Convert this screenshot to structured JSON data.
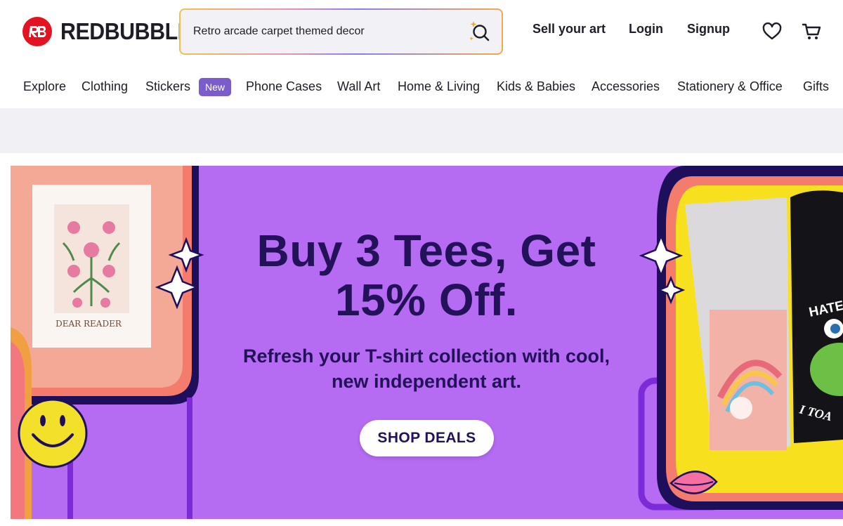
{
  "brand": {
    "name": "REDBUBBLE",
    "logo_color": "#e41321"
  },
  "search": {
    "value": "Retro arcade carpet themed decor",
    "icon": "search-sparkle-icon"
  },
  "header": {
    "sell_label": "Sell your art",
    "login_label": "Login",
    "signup_label": "Signup",
    "wishlist_icon": "heart-icon",
    "cart_icon": "cart-icon"
  },
  "categories": [
    {
      "label": "Explore"
    },
    {
      "label": "Clothing"
    },
    {
      "label": "Stickers",
      "badge": "New"
    },
    {
      "label": "Phone Cases"
    },
    {
      "label": "Wall Art"
    },
    {
      "label": "Home & Living"
    },
    {
      "label": "Kids & Babies"
    },
    {
      "label": "Accessories"
    },
    {
      "label": "Stationery & Office"
    },
    {
      "label": "Gifts"
    }
  ],
  "hero": {
    "title_line1": "Buy 3 Tees, Get",
    "title_line2": "15% Off.",
    "subtitle_line1": "Refresh your T-shirt collection with cool,",
    "subtitle_line2": "new independent art.",
    "cta_label": "SHOP DEALS",
    "background": "#b56bf2",
    "text_color": "#231159",
    "print_caption": "DEAR READER",
    "tee_text_top": "HATE",
    "tee_text_bottom": "I TOA"
  }
}
